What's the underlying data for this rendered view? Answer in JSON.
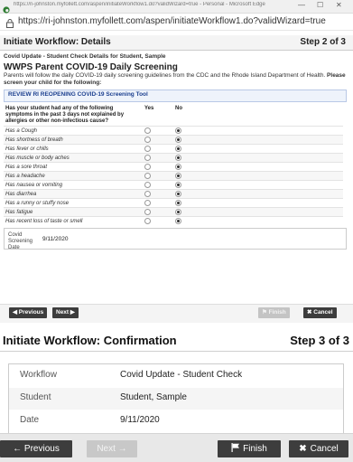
{
  "browser": {
    "titlebar_text": "https://ri-johnston.myfollett.com/aspen/initiateWorkflow1.do?validWizard=true - Personal - Microsoft Edge",
    "address_text": "https://ri-johnston.myfollett.com/aspen/initiateWorkflow1.do?validWizard=true",
    "minimize_glyph": "—",
    "maximize_glyph": "☐",
    "close_glyph": "✕",
    "lock_icon": "lock-icon"
  },
  "popup": {
    "header_title": "Initiate Workflow: Details",
    "header_step": "Step 2 of 3",
    "tag_line": "Covid Update - Student Check Details for Student, Sample",
    "form_title": "WWPS Parent COVID-19 Daily Screening",
    "description": "Parents will follow the daily COVID-19 daily screening guidelines from the CDC and the Rhode Island Department of Health.",
    "description_bold": "Please screen your child for the following:",
    "tool_link": "REVIEW RI REOPENING COVID-19 Screening Tool",
    "question_header": "Has your student had any of the following symptoms in the past 3 days not explained by allergies or other non-infectious cause?",
    "yes_label": "Yes",
    "no_label": "No",
    "symptoms": [
      {
        "label": "Has a Cough",
        "answer": "No"
      },
      {
        "label": "Has shortness of breath",
        "answer": "No"
      },
      {
        "label": "Has fever or chills",
        "answer": "No"
      },
      {
        "label": "Has muscle or body aches",
        "answer": "No"
      },
      {
        "label": "Has a sore throat",
        "answer": "No"
      },
      {
        "label": "Has a headache",
        "answer": "No"
      },
      {
        "label": "Has nausea or vomiting",
        "answer": "No"
      },
      {
        "label": "Has diarrhea",
        "answer": "No"
      },
      {
        "label": "Has a runny or stuffy nose",
        "answer": "No"
      },
      {
        "label": "Has fatigue",
        "answer": "No"
      },
      {
        "label": "Has recent loss of taste or smell",
        "answer": "No"
      }
    ],
    "date_label": "Covid Screening Date",
    "date_value": "9/11/2020",
    "previous_label": "◀ Previous",
    "next_label": "Next ▶",
    "finish_label": "⚑ Finish",
    "cancel_label": "✖ Cancel"
  },
  "confirmation": {
    "title": "Initiate Workflow: Confirmation",
    "step": "Step 3 of 3",
    "rows": [
      {
        "label": "Workflow",
        "value": "Covid Update - Student Check"
      },
      {
        "label": "Student",
        "value": "Student, Sample"
      },
      {
        "label": "Date",
        "value": "9/11/2020"
      }
    ]
  },
  "footer": {
    "previous_label": "← Previous",
    "next_label": "Next →",
    "finish_label": "Finish",
    "cancel_label": "Cancel"
  },
  "colors": {
    "button_dark": "#3d3d3d",
    "button_disabled": "#c8c8c8",
    "link_blue": "#1b3f8f"
  }
}
